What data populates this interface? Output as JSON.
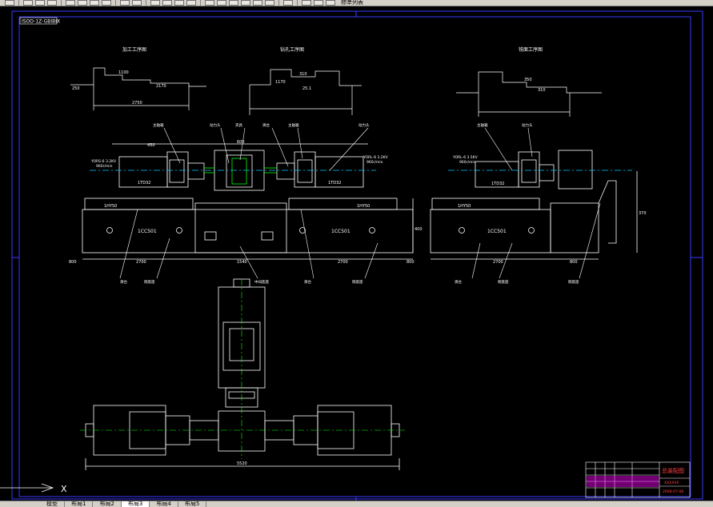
{
  "toolbar": {
    "layer_name": "標準列表"
  },
  "drawing": {
    "sheet_code": "ISOO-1Z-GBIBIX",
    "section_titles": [
      "加工工序图",
      "钻孔工序图",
      "铣面工序图"
    ],
    "dimensions": {
      "top_row": [
        "250",
        "1100",
        "2750",
        "1170",
        "2170",
        "350",
        "25.1",
        "310"
      ],
      "front_view": [
        "800",
        "2700",
        "1540",
        "2700",
        "800",
        "500",
        "325",
        "450",
        "600",
        "325",
        "400",
        "300"
      ],
      "side_view": [
        "2700",
        "800",
        "370",
        "720",
        "200",
        "310"
      ],
      "plan_view": [
        "5520"
      ]
    },
    "labels": {
      "motor_left": "YORS-6 3.2KV",
      "motor_left_sub": "960r/min",
      "motor_right": "YORL-6 3.2KV",
      "motor_right_sub": "960r/min",
      "motor_side": "YORL-6 3.5KV",
      "motor_side_sub": "960r/min",
      "slide_left": "1HY50",
      "slide_right": "1HY50",
      "slide_side": "1HY50",
      "head_left": "1TD32",
      "head_right": "1TD32",
      "head_side": "1TD32",
      "base_left": "1CC501",
      "base_right": "1CC501",
      "base_side": "1CC501"
    },
    "callouts": [
      "主轴箱",
      "动力头",
      "夹具",
      "滑台",
      "侧底座",
      "中间底座",
      "侧底座"
    ],
    "title_block": {
      "title": "总装配图",
      "company": "XXXXXX",
      "date": "2008-07-08"
    }
  },
  "ucs": {
    "x_label": "X"
  },
  "tabs": [
    {
      "label": "模型",
      "active": false
    },
    {
      "label": "布局1",
      "active": false
    },
    {
      "label": "布局2",
      "active": false
    },
    {
      "label": "布局3",
      "active": true
    },
    {
      "label": "布局4",
      "active": false
    },
    {
      "label": "布局5",
      "active": false
    }
  ]
}
